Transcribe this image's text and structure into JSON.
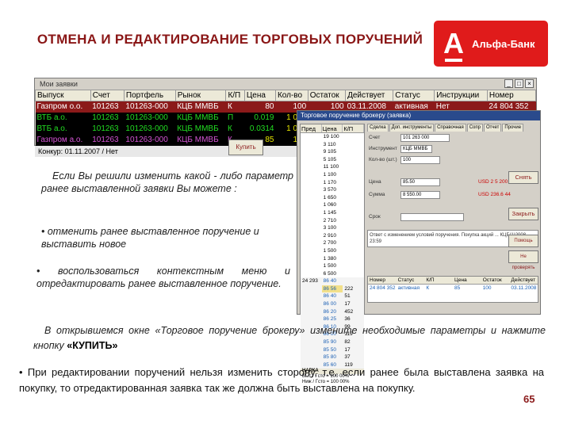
{
  "slide": {
    "title": "ОТМЕНА И РЕДАКТИРОВАНИЕ ТОРГОВЫХ ПОРУЧЕНИЙ",
    "logo_letter": "А",
    "logo_text": "Альфа-Банк",
    "page_number": "65"
  },
  "main_window": {
    "title": "Мои заявки",
    "columns": [
      "Выпуск",
      "Счет",
      "Портфель",
      "Рынок",
      "К/П",
      "Цена",
      "Кол-во",
      "Остаток",
      "Действует",
      "Статус",
      "Инструкции",
      "Номер"
    ],
    "rows": [
      [
        "Газпром о.о.",
        "101263",
        "101263-000",
        "КЦБ ММВБ",
        "К",
        "80",
        "100",
        "100",
        "03.11.2008",
        "активная",
        "Нет",
        "24 804 352"
      ],
      [
        "ВТБ а.о.",
        "101263",
        "101263-000",
        "КЦБ ММВБ",
        "П",
        "0.019",
        "1 000",
        "",
        "",
        "",
        "",
        ""
      ],
      [
        "ВТБ а.о.",
        "101263",
        "101263-000",
        "КЦБ ММВБ",
        "К",
        "0.0314",
        "1 000",
        "",
        "",
        "",
        "",
        ""
      ],
      [
        "Газпром а.о.",
        "101263",
        "101263-000",
        "КЦБ ММВБ",
        "К",
        "85",
        "100",
        "",
        "",
        "",
        "",
        ""
      ]
    ],
    "status": "Конкур: 01.11.2007 / Нет"
  },
  "notes": {
    "p1": "Если Вы решили изменить какой - либо параметр ранее выставленной заявки Вы можете :",
    "p2": "• отменить ранее выставленное поручение и выставить новое",
    "p3": "• воспользоваться контекстным меню и отредактировать ранее выставленное поручение."
  },
  "dialog": {
    "title": "Торговое поручение брокеру (заявка)",
    "book_headers": [
      "Пред",
      "Цена",
      "К/П"
    ],
    "book_rows": [
      [
        "",
        "19 100",
        ""
      ],
      [
        "",
        "3 110",
        ""
      ],
      [
        "",
        "9 105",
        ""
      ],
      [
        "",
        "5 105",
        ""
      ],
      [
        "",
        "11 100",
        ""
      ],
      [
        "",
        "1 100",
        ""
      ],
      [
        "",
        "1 170",
        ""
      ],
      [
        "",
        "3 570",
        ""
      ],
      [
        "",
        "1 650",
        ""
      ],
      [
        "",
        "1 060",
        ""
      ],
      [
        "",
        "1 145",
        ""
      ],
      [
        "",
        "2 710",
        ""
      ],
      [
        "",
        "3 100",
        ""
      ],
      [
        "",
        "2 910",
        ""
      ],
      [
        "",
        "2 700",
        ""
      ],
      [
        "",
        "1 500",
        ""
      ],
      [
        "",
        "1 380",
        ""
      ],
      [
        "",
        "1 500",
        ""
      ],
      [
        "",
        "6 500",
        ""
      ],
      [
        "24 293",
        "86 40",
        ""
      ],
      [
        "",
        "86 56",
        "222"
      ],
      [
        "",
        "86 40",
        "51"
      ],
      [
        "",
        "86 00",
        "17"
      ],
      [
        "",
        "86 20",
        "452"
      ],
      [
        "",
        "86 25",
        "36"
      ],
      [
        "",
        "86 10",
        "99"
      ],
      [
        "",
        "86 00",
        "119"
      ],
      [
        "",
        "85 90",
        "82"
      ],
      [
        "",
        "85 50",
        "17"
      ],
      [
        "",
        "85 80",
        "37"
      ],
      [
        "",
        "85 60",
        "119"
      ]
    ],
    "book_footer": [
      "НАРКА",
      "Выс / Гсто = 100 00%",
      "Ниж / Гсто = 100 00%"
    ],
    "tabs": [
      "Сделка",
      "Доп. инструменты",
      "Справочная",
      "Сопр",
      "Отчет",
      "Прочие"
    ],
    "fields": {
      "account_label": "Счет",
      "account_value": "101 263 000",
      "instrument_label": "Инструмент",
      "instrument_value": "КЦБ ММВБ",
      "qty_label": "Кол-во (шт.)",
      "qty_value": "100",
      "price_label": "Цена",
      "price_value": "85.50",
      "sum_label": "Сумма",
      "sum_value": "8 550.00",
      "usd1": "USD 2 5 200",
      "usd2": "USD 236.6 44",
      "term_label": "Срок"
    },
    "message": "Ответ с изменением условий поручения. Покупка акций ... КЦБ(1)2008 23:59",
    "buttons": {
      "buy": "Купить",
      "cancel": "Снять",
      "close": "Закрыть",
      "help": "Помощь",
      "refresh": "Не проверять"
    },
    "sub_headers": [
      "Номер",
      "Статус",
      "К/П",
      "Цена",
      "Остаток",
      "Действует"
    ],
    "sub_row": [
      "24 804 352",
      "активная",
      "К",
      "85",
      "100",
      "03.11.2008"
    ]
  },
  "caption": {
    "text": "В открывшемся окне «Торговое поручение брокеру» измените необходимые параметры и нажмите кнопку ",
    "bold": "«КУПИТЬ»"
  },
  "bullet": "• При редактировании поручений нельзя изменить сторону, т.е. если ранее была выставлена заявка на покупку, то отредактированная заявка так же должна быть выставлена на покупку."
}
